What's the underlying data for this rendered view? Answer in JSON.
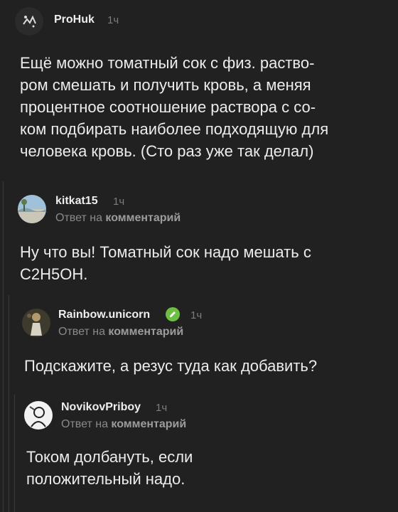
{
  "comments": [
    {
      "author": "ProHuk",
      "time": "1ч",
      "reply_prefix": "",
      "reply_target": "",
      "text_lines": [
        "Ещё можно томатный сок с физ. раство-",
        "ром смешать и получить кровь, а меняя",
        "процентное соотношение раствора с со-",
        "ком подбирать наиболее подходящую для",
        "человека кровь. (Сто раз уже так делал)"
      ],
      "avatar_icon": "hand-drawn-avatar-icon"
    },
    {
      "author": "kitkat15",
      "time": "1ч",
      "reply_prefix": "Ответ на",
      "reply_target": "комментарий",
      "text_lines": [
        "Ну что вы! Томатный сок надо мешать с",
        "С2Н5ОН."
      ],
      "avatar_icon": "landscape-avatar-icon"
    },
    {
      "author": "Rainbow.unicorn",
      "time": "1ч",
      "reply_prefix": "Ответ на",
      "reply_target": "комментарий",
      "text_lines": [
        "Подскажите, а резус туда как добавить?"
      ],
      "avatar_icon": "figure-avatar-icon",
      "verified_icon": "verified-pencil-icon",
      "verified_color": "#6cbf43"
    },
    {
      "author": "NovikovPriboy",
      "time": "1ч",
      "reply_prefix": "Ответ на",
      "reply_target": "комментарий",
      "text_lines": [
        "Током долбануть, если",
        "положительный надо."
      ],
      "avatar_icon": "sketch-avatar-icon"
    }
  ],
  "colors": {
    "background": "#212121",
    "thread_line": "#3a3a3a",
    "muted_text": "#7d7d7d"
  }
}
